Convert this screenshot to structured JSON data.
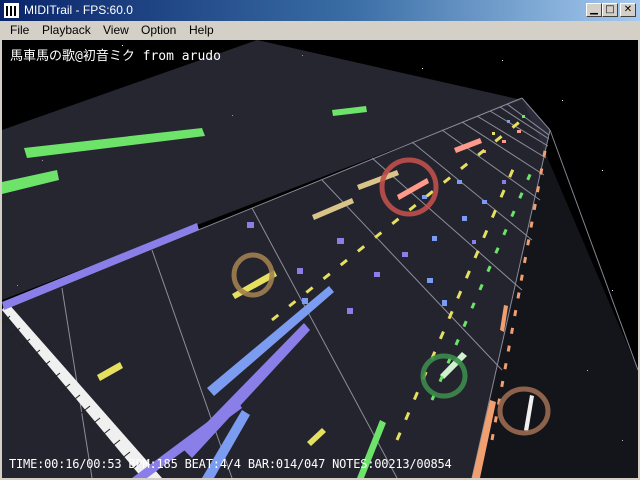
{
  "window": {
    "title": "MIDITrail - FPS:60.0"
  },
  "menubar": {
    "items": [
      "File",
      "Playback",
      "View",
      "Option",
      "Help"
    ]
  },
  "viewer": {
    "song_title": "馬車馬の歌@初音ミク from arudo",
    "status_line": "TIME:00:16/00:53 BPM:185 BEAT:4/4 BAR:014/047 NOTES:00213/00854"
  },
  "colors": {
    "title_gradient_start": "#0a246a",
    "title_gradient_end": "#a6caf0",
    "window_face": "#d4d0c8",
    "background": "#000000"
  },
  "icons": {
    "minimize": "minimize-icon",
    "maximize": "maximize-icon",
    "close": "close-icon",
    "app": "keyboard-icon"
  }
}
